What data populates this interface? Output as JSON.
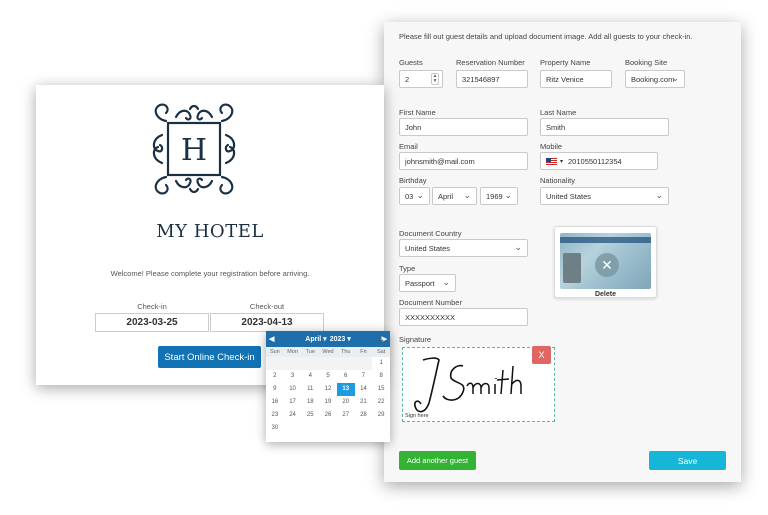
{
  "form": {
    "instructions": "Please fill out guest details and upload document image. Add all guests to your check-in.",
    "guests": {
      "label": "Guests",
      "value": "2"
    },
    "reservation": {
      "label": "Reservation Number",
      "value": "321546897"
    },
    "property": {
      "label": "Property Name",
      "value": "Ritz Venice"
    },
    "booking": {
      "label": "Booking Site",
      "value": "Booking.com"
    },
    "first_name": {
      "label": "First Name",
      "value": "John"
    },
    "last_name": {
      "label": "Last Name",
      "value": "Smith"
    },
    "email": {
      "label": "Email",
      "value": "johnsmith@mail.com"
    },
    "mobile": {
      "label": "Mobile",
      "value": "2010550112354"
    },
    "birthday": {
      "label": "Birthday",
      "day": "03",
      "month": "April",
      "year": "1969"
    },
    "nationality": {
      "label": "Nationality",
      "value": "United States"
    },
    "doc_country": {
      "label": "Document Country",
      "value": "United States"
    },
    "type": {
      "label": "Type",
      "value": "Passport"
    },
    "doc_number": {
      "label": "Document Number",
      "value": "XXXXXXXXXX"
    },
    "signature": {
      "label": "Signature",
      "sign_here": "Sign here",
      "clear": "X"
    },
    "id_delete": "Delete",
    "add_guest": "Add another guest",
    "save": "Save"
  },
  "hotel": {
    "initial": "H",
    "name": "MY HOTEL",
    "welcome": "Welcome! Please complete your registration before arriving.",
    "checkin": {
      "label": "Check-in",
      "value": "2023-03-25"
    },
    "checkout": {
      "label": "Check-out",
      "value": "2023-04-13"
    },
    "start_button": "Start Online Check-in"
  },
  "calendar": {
    "month": "April",
    "year": "2023",
    "weekdays": [
      "Sun",
      "Mon",
      "Tue",
      "Wed",
      "Thu",
      "Fri",
      "Sat"
    ],
    "leading_blanks": 6,
    "days": 30,
    "selected": 13
  },
  "colors": {
    "start_button": "#1173b4",
    "add_guest": "#34b233",
    "save": "#16b6d9",
    "calendar_header": "#1d6fab",
    "calendar_selected": "#1d9be0",
    "signature_clear": "#e06666"
  }
}
